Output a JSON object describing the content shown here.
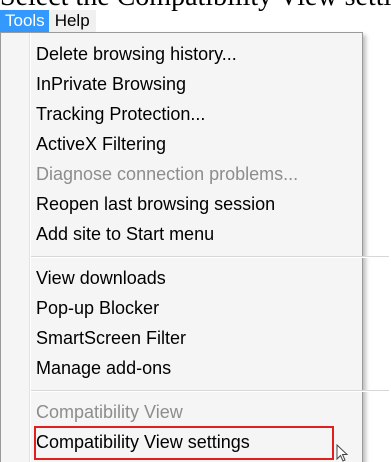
{
  "top_text": "Select the Compatibility View settings",
  "menubar": {
    "items": [
      {
        "label": "Tools",
        "active": true
      },
      {
        "label": "Help",
        "active": false
      }
    ]
  },
  "menu": {
    "items": [
      {
        "label": "Delete browsing history...",
        "enabled": true
      },
      {
        "label": "InPrivate Browsing",
        "enabled": true
      },
      {
        "label": "Tracking Protection...",
        "enabled": true
      },
      {
        "label": "ActiveX Filtering",
        "enabled": true
      },
      {
        "label": "Diagnose connection problems...",
        "enabled": false
      },
      {
        "label": "Reopen last browsing session",
        "enabled": true
      },
      {
        "label": "Add site to Start menu",
        "enabled": true
      },
      {
        "label": "View downloads",
        "enabled": true
      },
      {
        "label": "Pop-up Blocker",
        "enabled": true
      },
      {
        "label": "SmartScreen Filter",
        "enabled": true
      },
      {
        "label": "Manage add-ons",
        "enabled": true
      },
      {
        "label": "Compatibility View",
        "enabled": false
      },
      {
        "label": "Compatibility View settings",
        "enabled": true,
        "highlighted": true
      }
    ]
  },
  "colors": {
    "menubar_active": "#3399ff",
    "highlight_border": "#e0201e",
    "disabled_text": "#8d8d8d"
  },
  "icons": {
    "cursor": "mouse-pointer-icon"
  }
}
